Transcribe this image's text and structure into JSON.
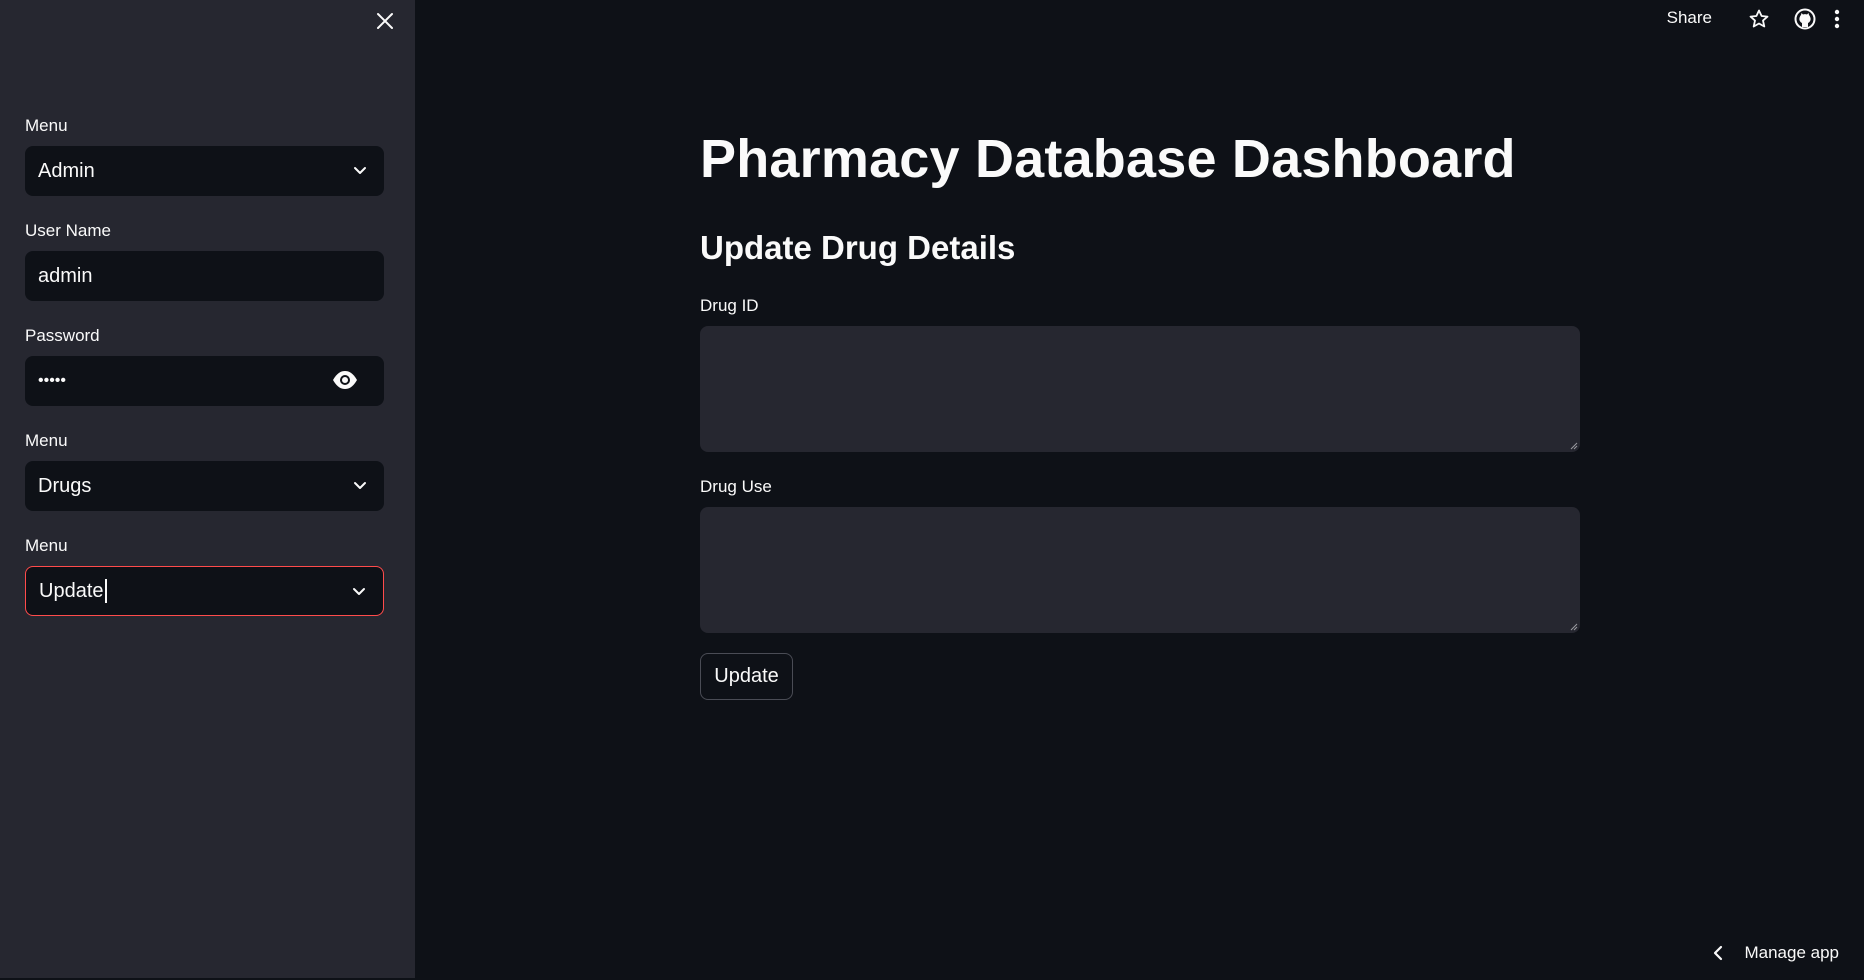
{
  "sidebar": {
    "menu1": {
      "label": "Menu",
      "value": "Admin"
    },
    "username": {
      "label": "User Name",
      "value": "admin"
    },
    "password": {
      "label": "Password",
      "value": "•••••"
    },
    "menu2": {
      "label": "Menu",
      "value": "Drugs"
    },
    "menu3": {
      "label": "Menu",
      "value": "Update"
    }
  },
  "toolbar": {
    "share_label": "Share",
    "icons": [
      "star-icon",
      "github-icon",
      "more-vertical-icon"
    ]
  },
  "main": {
    "title": "Pharmacy Database Dashboard",
    "section_title": "Update Drug Details",
    "drug_id_label": "Drug ID",
    "drug_id_value": "",
    "drug_use_label": "Drug Use",
    "drug_use_value": "",
    "update_button": "Update"
  },
  "footer": {
    "manage_app": "Manage app"
  },
  "colors": {
    "background": "#0e1117",
    "sidebar": "#262730",
    "accent": "#ff4b4b",
    "text": "#fafafa"
  }
}
